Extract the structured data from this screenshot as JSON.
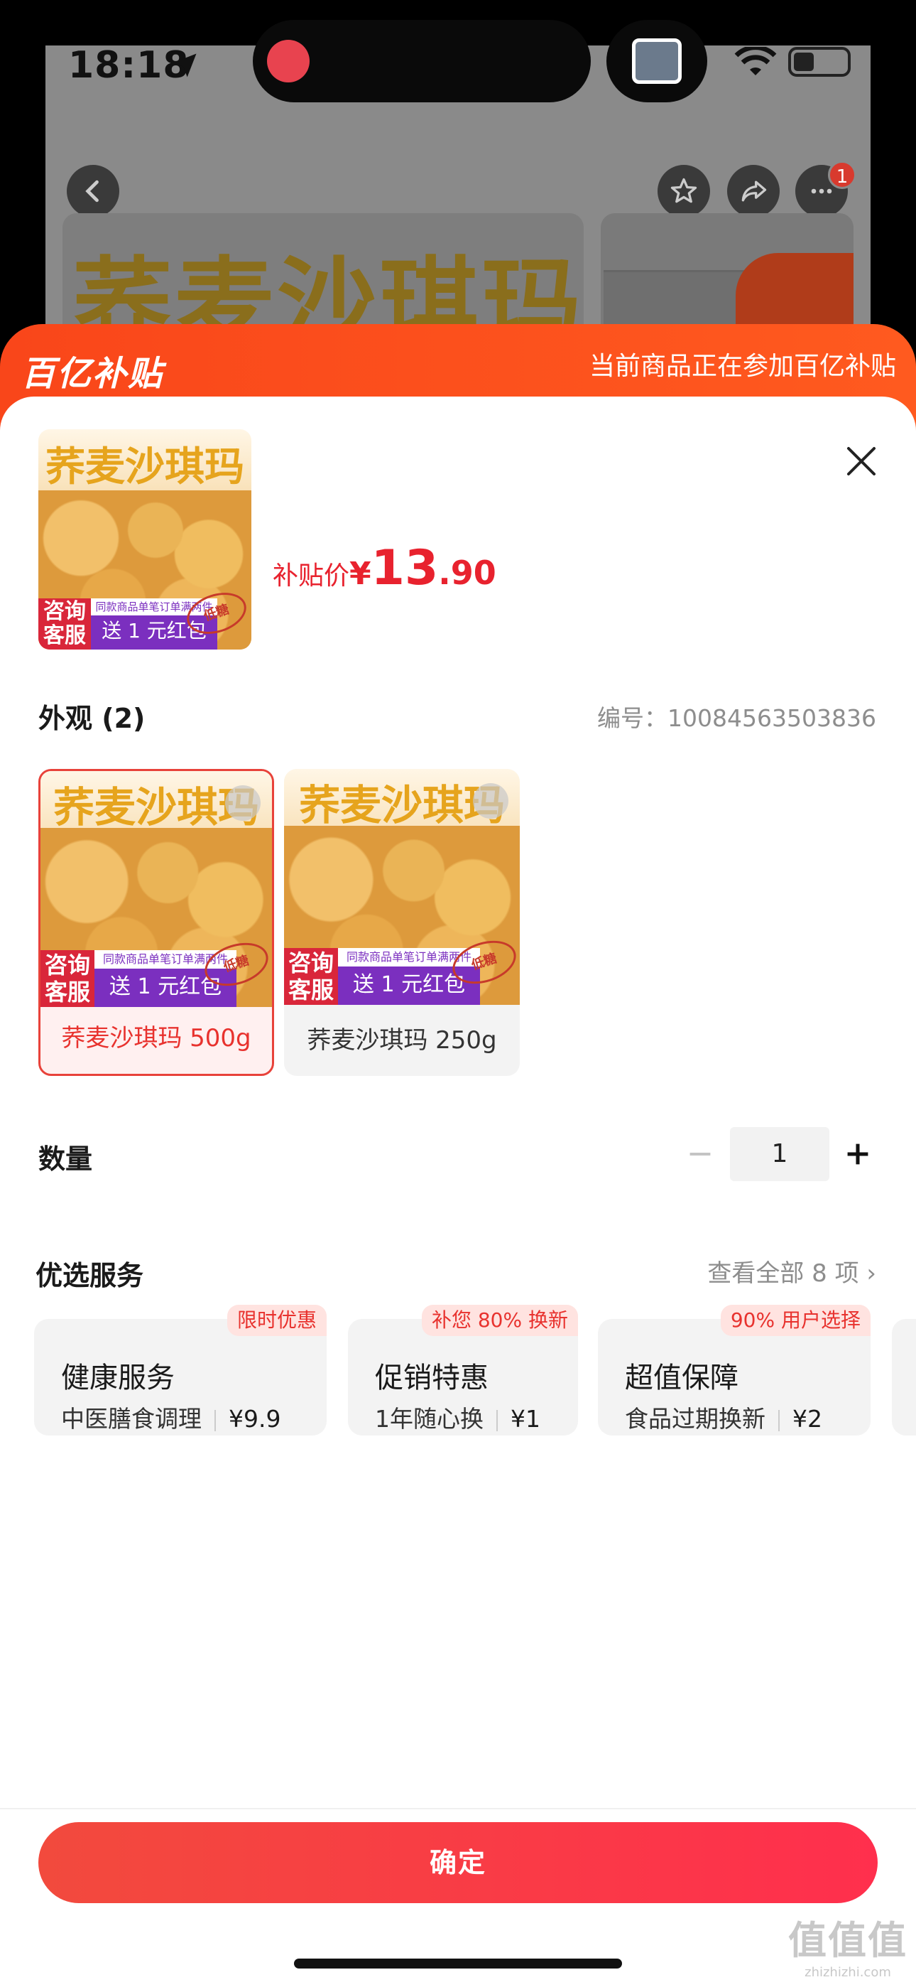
{
  "status_bar": {
    "time": "18:18"
  },
  "background": {
    "banner_title": "荞麦沙琪玛",
    "badge_count": "1"
  },
  "sheet_header": {
    "logo": "百亿补贴",
    "note": "当前商品正在参加百亿补贴"
  },
  "product": {
    "image_title": "荞麦沙琪玛",
    "image_cs": "咨询客服",
    "image_promo_small": "同款商品单笔订单满两件",
    "image_promo": "送 1 元红包",
    "image_stamp": "低糖",
    "price_label": "补贴价",
    "currency": "¥",
    "price_int": "13",
    "price_dec": ".90"
  },
  "appearance": {
    "title": "外观 (2)",
    "code_label": "编号：",
    "code": "10084563503836",
    "variants": [
      {
        "label": "荞麦沙琪玛 500g",
        "selected": true
      },
      {
        "label": "荞麦沙琪玛 250g",
        "selected": false
      }
    ]
  },
  "quantity": {
    "title": "数量",
    "value": "1"
  },
  "services": {
    "title": "优选服务",
    "see_all": "查看全部 8 项",
    "items": [
      {
        "tag": "限时优惠",
        "name": "健康服务",
        "desc": "中医膳食调理",
        "price": "¥9.9"
      },
      {
        "tag": "补您 80% 换新",
        "name": "促销特惠",
        "desc": "1年随心换",
        "price": "¥1"
      },
      {
        "tag": "90% 用户选择",
        "name": "超值保障",
        "desc": "食品过期换新",
        "price": "¥2"
      }
    ]
  },
  "confirm_label": "确定",
  "watermark": {
    "main": "值值值",
    "sub": "zhizhizhi.com"
  }
}
